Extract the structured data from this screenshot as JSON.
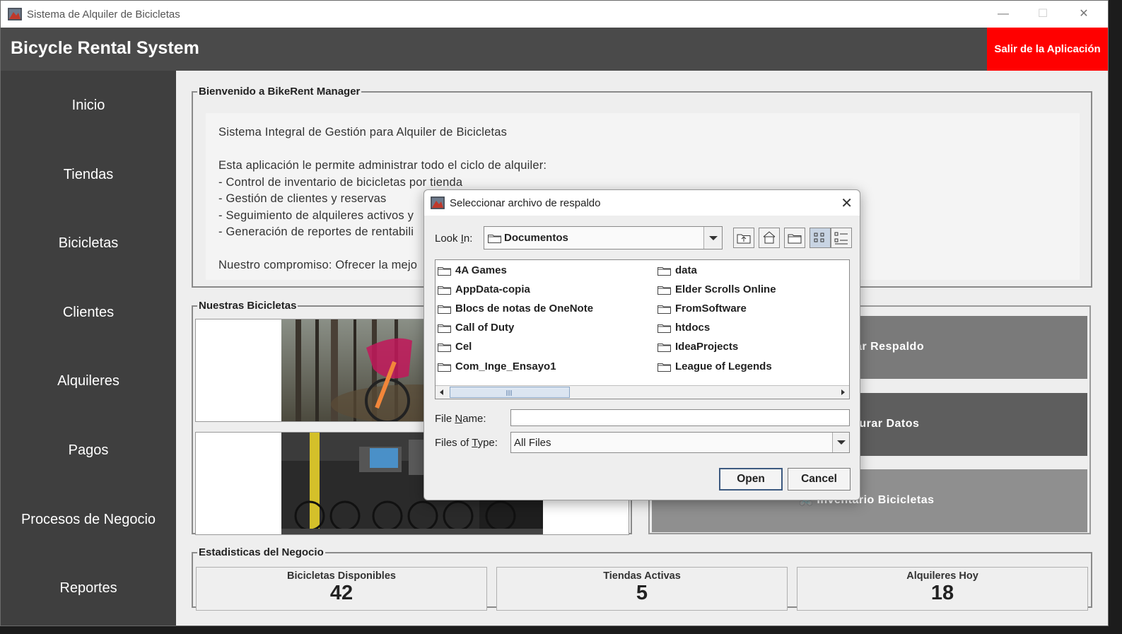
{
  "window": {
    "title": "Sistema de Alquiler de Bicicletas",
    "controls": {
      "minimize": "—",
      "maximize": "☐",
      "close": "✕"
    }
  },
  "header": {
    "brand": "Bicycle Rental System",
    "exit_label": "Salir de la Aplicación"
  },
  "sidebar": {
    "items": [
      {
        "label": "Inicio"
      },
      {
        "label": "Tiendas"
      },
      {
        "label": "Bicicletas"
      },
      {
        "label": "Clientes"
      },
      {
        "label": "Alquileres"
      },
      {
        "label": "Pagos"
      },
      {
        "label": "Procesos de Negocio"
      },
      {
        "label": "Reportes"
      }
    ]
  },
  "welcome": {
    "title": "Bienvenido a BikeRent Manager",
    "lines": [
      "Sistema Integral de Gestión para Alquiler de Bicicletas",
      "",
      "Esta aplicación le permite administrar todo el ciclo de alquiler:",
      "- Control de inventario de bicicletas por tienda",
      "- Gestión de clientes y reservas",
      "- Seguimiento de alquileres activos y",
      "- Generación de reportes de rentabili",
      "",
      "Nuestro compromiso: Ofrecer la mejo"
    ]
  },
  "bikes": {
    "title": "Nuestras Bicicletas"
  },
  "actions": {
    "backup_label": "ar Respaldo",
    "restore_label": "aurar Datos",
    "inventory_label": "🚲 Inventario Bicicletas",
    "colors": {
      "backup": "#7a7a7a",
      "restore": "#5e5e5e",
      "inventory": "#8f8f8f"
    }
  },
  "stats": {
    "title": "Estadisticas del Negocio",
    "cards": [
      {
        "label": "Bicicletas Disponibles",
        "value": "42"
      },
      {
        "label": "Tiendas Activas",
        "value": "5"
      },
      {
        "label": "Alquileres Hoy",
        "value": "18"
      }
    ]
  },
  "dialog": {
    "title": "Seleccionar archivo de respaldo",
    "look_in_label_pre": "Look ",
    "look_in_label_u": "I",
    "look_in_label_post": "n:",
    "look_in_value": "Documentos",
    "toolbar_icons": [
      "up-one-level-icon",
      "home-icon",
      "new-folder-icon",
      "list-view-icon",
      "details-view-icon"
    ],
    "files_col1": [
      "4A Games",
      "AppData-copia",
      "Blocs de notas de OneNote",
      "Call of Duty",
      "Cel",
      "Com_Inge_Ensayo1"
    ],
    "files_col2": [
      "data",
      "Elder Scrolls Online",
      "FromSoftware",
      "htdocs",
      "IdeaProjects",
      "League of Legends"
    ],
    "file_name_label_pre": "File ",
    "file_name_label_u": "N",
    "file_name_label_post": "ame:",
    "file_name_value": "",
    "files_of_type_label_pre": "Files of ",
    "files_of_type_label_u": "T",
    "files_of_type_label_post": "ype:",
    "files_of_type_value": "All Files",
    "open_label": "Open",
    "cancel_label": "Cancel"
  }
}
